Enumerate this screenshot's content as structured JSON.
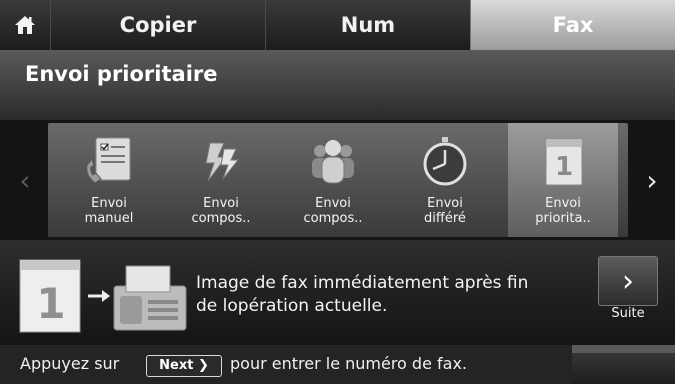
{
  "tabs": {
    "home_icon": "home-icon",
    "copier": "Copier",
    "num": "Num",
    "fax": "Fax"
  },
  "title": "Envoi prioritaire",
  "functions": [
    {
      "icon": "manual-send-icon",
      "line1": "Envoi",
      "line2": "manuel"
    },
    {
      "icon": "compose-send-icon",
      "line1": "Envoi",
      "line2": "compos.."
    },
    {
      "icon": "group-send-icon",
      "line1": "Envoi",
      "line2": "compos.."
    },
    {
      "icon": "timer-icon",
      "line1": "Envoi",
      "line2": "différé"
    },
    {
      "icon": "priority-page-icon",
      "line1": "Envoi",
      "line2": "priorita.."
    }
  ],
  "description": {
    "line1": "Image de fax immédiatement après fin",
    "line2": "de lopération actuelle."
  },
  "suite_label": "Suite",
  "hint": {
    "pre": "Appuyez sur",
    "key": "Next ❯",
    "post": "pour entrer le numéro de fax."
  },
  "colors": {
    "active_tab": "#bfbfbf",
    "background": "#1a1a1a"
  }
}
